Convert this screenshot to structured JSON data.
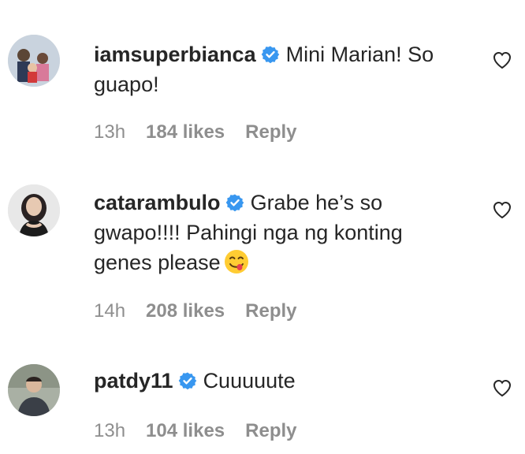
{
  "comments": [
    {
      "username": "iamsuperbianca",
      "text": "Mini Marian! So guapo!",
      "time": "13h",
      "likes": "184 likes",
      "reply_label": "Reply"
    },
    {
      "username": "catarambulo",
      "text": "Grabe he’s so gwapo!!!! Pahingi nga ng konting genes please",
      "time": "14h",
      "likes": "208 likes",
      "reply_label": "Reply"
    },
    {
      "username": "patdy11",
      "text": "Cuuuuute",
      "time": "13h",
      "likes": "104 likes",
      "reply_label": "Reply"
    }
  ],
  "icons": {
    "verified": "verified-badge-icon",
    "like": "heart-outline-icon",
    "emoji": "face-savoring-food-emoji"
  },
  "colors": {
    "verified": "#3897f0",
    "meta": "#8e8e8e",
    "text": "#262626"
  }
}
